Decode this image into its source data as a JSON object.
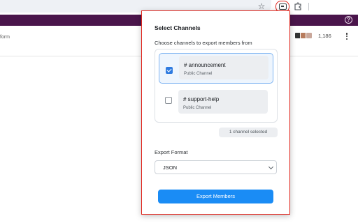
{
  "browser": {
    "icons": [
      "star-icon",
      "extension-icon",
      "puzzle-icon"
    ],
    "extension_highlight_color": "#e1231b"
  },
  "app": {
    "header_color": "#4a154b",
    "help_label": "?",
    "header_text": "form",
    "member_count": "1,186"
  },
  "popup": {
    "title": "Select Channels",
    "subtitle": "Choose channels to export members from",
    "channels": [
      {
        "name": "# announcement",
        "type": "Public Channel",
        "checked": true
      },
      {
        "name": "# support-help",
        "type": "Public Channel",
        "checked": false
      }
    ],
    "selection_status": "1 channel selected",
    "format_label": "Export Format",
    "format_value": "JSON",
    "export_button": "Export Members",
    "accent_color": "#1a8cf5"
  }
}
